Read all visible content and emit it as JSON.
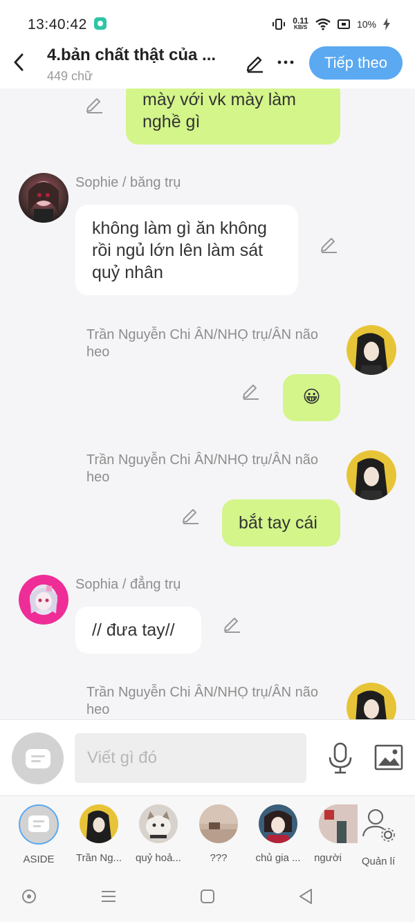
{
  "status": {
    "time": "13:40:42",
    "net_speed": "0.11",
    "net_unit": "KB/S",
    "battery": "10%"
  },
  "header": {
    "title": "4.bản chất thật của ...",
    "word_count": "449 chữ",
    "next_label": "Tiếp theo"
  },
  "messages": [
    {
      "text": "mày với vk mày làm nghề gì"
    },
    {
      "author": "Sophie / băng trụ",
      "text": "không làm gì ăn không rồi ngủ lớn lên làm sát quỷ nhân"
    },
    {
      "author": "Trần Nguyễn Chi ÂN/NHỌ trụ/ÂN não heo",
      "text": "😀"
    },
    {
      "author": "Trần Nguyễn Chi ÂN/NHỌ trụ/ÂN não heo",
      "text": "bắt tay cái"
    },
    {
      "author": "Sophia / đẳng trụ",
      "text": "// đưa tay//"
    },
    {
      "author": "Trần Nguyễn Chi ÂN/NHỌ trụ/ÂN não heo"
    }
  ],
  "composer": {
    "placeholder": "Viết gì đó"
  },
  "participants": [
    {
      "label": "ASIDE"
    },
    {
      "label": "Trần Ng..."
    },
    {
      "label": "quỷ hoả..."
    },
    {
      "label": "???"
    },
    {
      "label": "chủ gia ..."
    },
    {
      "label": "người"
    },
    {
      "label": "Quản lí"
    }
  ],
  "colors": {
    "accent": "#5aa9f1",
    "my_bubble": "#d3f58a",
    "other_bubble": "#ffffff",
    "background": "#f5f5f7"
  }
}
